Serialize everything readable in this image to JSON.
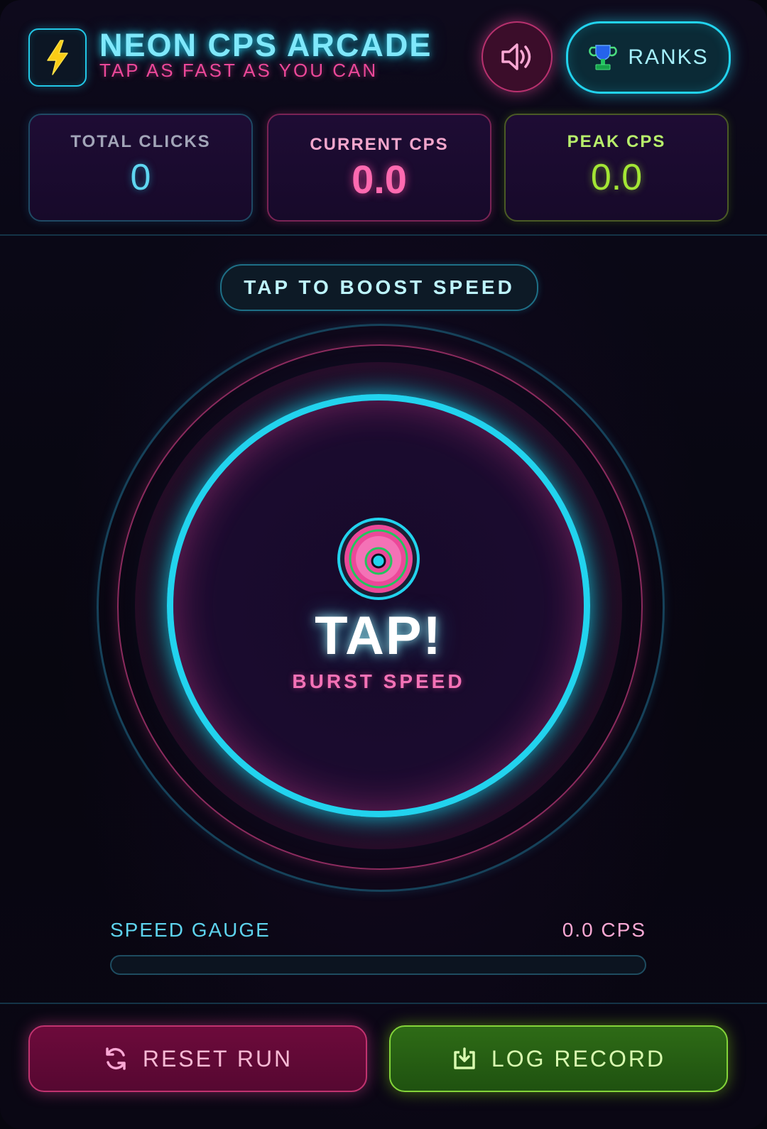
{
  "header": {
    "title": "NEON CPS ARCADE",
    "subtitle": "TAP AS FAST AS YOU CAN",
    "logo_icon": "lightning-bolt-icon",
    "sound_icon": "speaker-icon",
    "ranks_icon": "trophy-icon",
    "ranks_label": "RANKS"
  },
  "stats": {
    "total_clicks": {
      "label": "TOTAL CLICKS",
      "value": "0"
    },
    "current_cps": {
      "label": "CURRENT CPS",
      "value": "0.0"
    },
    "peak_cps": {
      "label": "PEAK CPS",
      "value": "0.0"
    }
  },
  "play_area": {
    "hint": "TAP TO BOOST SPEED",
    "tap_label": "TAP!",
    "tap_sublabel": "BURST SPEED",
    "target_icon": "target-icon"
  },
  "gauge": {
    "label": "SPEED GAUGE",
    "value_text": "0.0 CPS",
    "fill_fraction": 0
  },
  "footer": {
    "reset_label": "RESET RUN",
    "reset_icon": "refresh-icon",
    "log_label": "LOG RECORD",
    "log_icon": "download-icon"
  },
  "colors": {
    "cyan": "#22d3ee",
    "pink": "#ec4899",
    "lime": "#a3e635",
    "background": "#07060f"
  }
}
